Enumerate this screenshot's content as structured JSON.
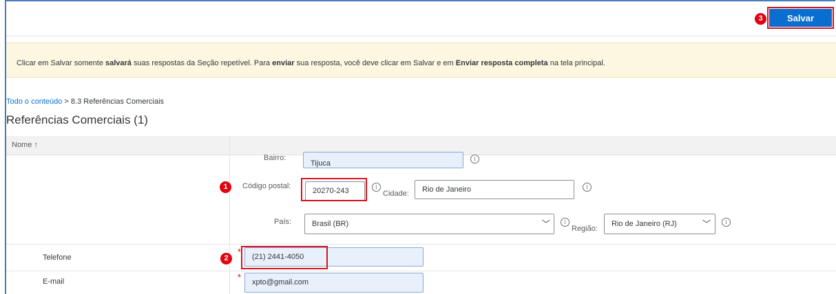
{
  "toolbar": {
    "save_label": "Salvar"
  },
  "markers": {
    "one": "1",
    "two": "2",
    "three": "3"
  },
  "banner": {
    "part1": "Clicar em Salvar somente ",
    "bold1": "salvará",
    "part2": " suas respostas da Seção repetível. Para ",
    "bold2": "enviar",
    "part3": " sua resposta, você deve clicar em Salvar e em ",
    "bold3": "Enviar resposta completa",
    "part4": " na tela principal."
  },
  "breadcrumb": {
    "link": "Todo o conteúdo",
    "separator": " > ",
    "current": "8.3 Referências Comerciais"
  },
  "page": {
    "title": "Referências Comerciais (1)"
  },
  "table": {
    "col_name": "Nome ↑"
  },
  "form": {
    "bairro_label": "Bairro:",
    "bairro_value": "Tijuca",
    "cep_label": "Código postal:",
    "cep_value": "20270-243",
    "cidade_label": "Cidade:",
    "cidade_value": "Rio de Janeiro",
    "pais_label": "País:",
    "pais_value": "Brasil (BR)",
    "regiao_label": "Região:",
    "regiao_value": "Rio de Janeiro (RJ)",
    "telefone_label": "Telefone",
    "telefone_value": "(21) 2441-4050",
    "email_label": "E-mail",
    "email_value": "xpto@gmail.com",
    "required_mark": "*",
    "info_glyph": "i"
  }
}
